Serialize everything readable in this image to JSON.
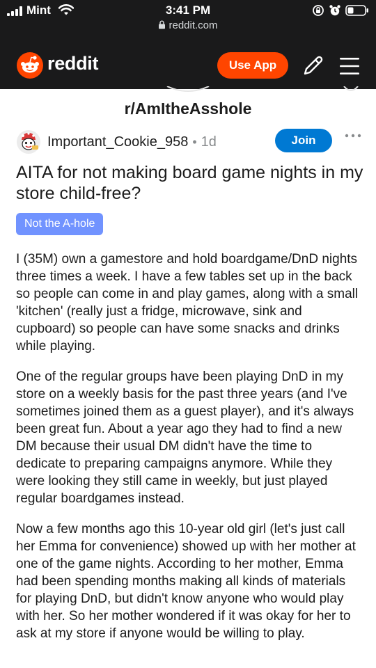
{
  "status_bar": {
    "carrier": "Mint",
    "time": "3:41 PM"
  },
  "url_bar": {
    "domain": "reddit.com"
  },
  "header": {
    "logo_text": "reddit",
    "use_app_label": "Use App",
    "brand_color": "#ff4500"
  },
  "subreddit": {
    "name": "r/AmItheAsshole"
  },
  "post": {
    "author": "Important_Cookie_958",
    "separator": "•",
    "age": "1d",
    "join_label": "Join",
    "title": "AITA for not making board game nights in my store child-free?",
    "flair": "Not the A-hole",
    "flair_color": "#7193ff",
    "paragraphs": [
      "I (35M) own a gamestore and hold boardgame/DnD nights three times a week. I have a few tables set up in the back so people can come in and play games, along with a small 'kitchen' (really just a fridge, microwave, sink and cupboard) so people can have some snacks and drinks while playing.",
      "One of the regular groups have been playing DnD in my store on a weekly basis for the past three years (and I've sometimes joined them as a guest player), and it's always been great fun. About a year ago they had to find a new DM because their usual DM didn't have the time to dedicate to preparing campaigns anymore. While they were looking they still came in weekly, but just played regular boardgames instead.",
      "Now a few months ago this 10-year old girl (let's just call her Emma for convenience) showed up with her mother at one of the game nights. According to her mother, Emma had been spending months making all kinds of materials for playing DnD, but didn't know anyone who would play with her. So her mother wondered if it was okay for her to ask at my store if anyone would be willing to play."
    ]
  }
}
